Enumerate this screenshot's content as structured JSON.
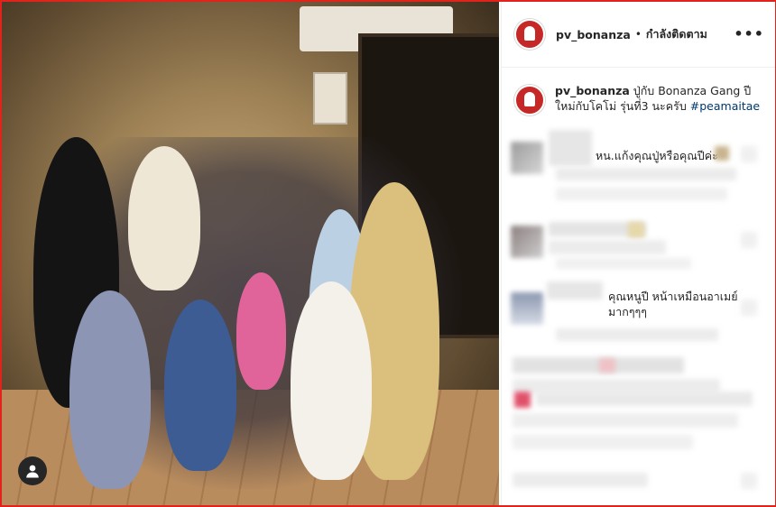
{
  "post": {
    "username": "pv_bonanza",
    "separator": "•",
    "follow_label": "กำลังติดตาม",
    "more_icon": "more-options-icon",
    "caption": {
      "username": "pv_bonanza",
      "text": " ปู่กับ Bonanza Gang ปีใหม่กับโคโม่ รุ่นที่3 นะครับ ",
      "hashtag": "#peamaitae"
    }
  },
  "comments": [
    {
      "text": "หน.แก้งคุณปู่หรือคุณปีค่ะ"
    },
    {
      "text": "คุณหนูปี หน้าเหมือนอาเมย์มากๆๆๆ"
    }
  ],
  "colors": {
    "border": "#e3231b",
    "avatar": "#c62828",
    "hashtag": "#00376b"
  }
}
